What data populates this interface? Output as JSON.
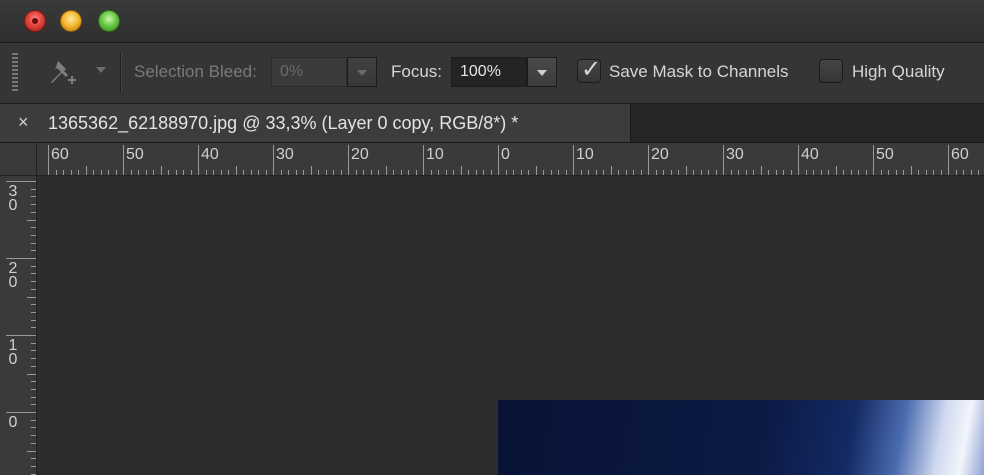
{
  "window": {
    "traffic_lights": [
      "close-button",
      "minimize-button",
      "maximize-button"
    ]
  },
  "options_bar": {
    "tool_icon": "pin-tool-icon",
    "selection_bleed_label": "Selection Bleed:",
    "selection_bleed_value": "0%",
    "focus_label": "Focus:",
    "focus_value": "100%",
    "save_mask_checked": true,
    "save_mask_label": "Save Mask to Channels",
    "high_quality_checked": false,
    "high_quality_label": "High Quality"
  },
  "document_tab": {
    "close_glyph": "×",
    "title": "1365362_62188970.jpg @ 33,3% (Layer 0 copy, RGB/8*) *"
  },
  "rulers": {
    "horizontal_labels": [
      "60",
      "50",
      "40",
      "30",
      "20",
      "10",
      "0",
      "10",
      "20",
      "30",
      "40",
      "50",
      "60"
    ],
    "vertical_labels": [
      [
        "3",
        "0"
      ],
      [
        "2",
        "0"
      ],
      [
        "1",
        "0"
      ],
      [
        "0"
      ]
    ]
  }
}
